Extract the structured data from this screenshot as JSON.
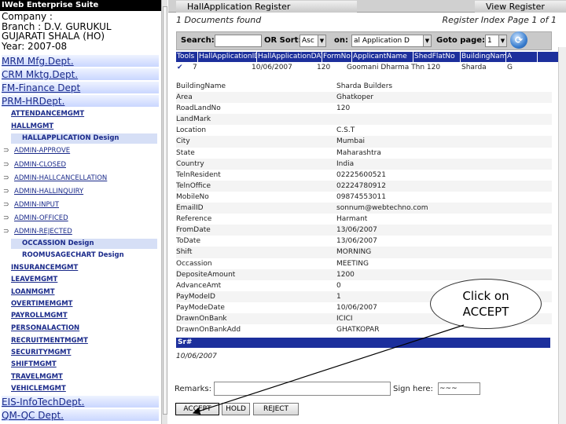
{
  "sidebar": {
    "app_title": "IWeb Enterprise Suite",
    "org": [
      "Company :",
      "Branch : D.V. GURUKUL",
      "GUJARATI SHALA (HO)",
      "Year: 2007-08"
    ],
    "depts_top": [
      "MRM Mfg.Dept.",
      "CRM Mktg.Dept.",
      "FM-Finance Dept",
      "PRM-HRDept."
    ],
    "menus_top": [
      "ATTENDANCEMGMT",
      "HALLMGMT"
    ],
    "design_row_1": "HALLAPPLICATION Design",
    "subs": [
      "ADMIN-APPROVE",
      "ADMIN-CLOSED",
      "ADMIN-HALLCANCELLATION",
      "ADMIN-HALLINQUIRY",
      "ADMIN-INPUT",
      "ADMIN-OFFICED",
      "ADMIN-REJECTED"
    ],
    "occasion_row": "OCCASSION Design",
    "roomusage_row": "ROOMUSAGECHART Design",
    "menus_bottom": [
      "INSURANCEMGMT",
      "LEAVEMGMT",
      "LOANMGMT",
      "OVERTIMEMGMT",
      "PAYROLLMGMT",
      "PERSONALACTION",
      "RECRUITMENTMGMT",
      "SECURITYMGMT",
      "SHIFTMGMT",
      "TRAVELMGMT",
      "VEHICLEMGMT"
    ],
    "depts_bottom": [
      "EIS-InfoTechDept.",
      "QM-QC Dept."
    ]
  },
  "tabs": {
    "hall": "HallApplication Register",
    "view": "View Register"
  },
  "status": {
    "docs_found": "1 Documents found",
    "reg_index": "Register Index Page 1 of 1"
  },
  "search": {
    "label": "Search:",
    "or_sort": "OR Sort:",
    "sort_value": "Asc",
    "on": "on:",
    "on_value": "al Application D",
    "goto": "Goto page:",
    "goto_value": "1"
  },
  "grid": {
    "headers": [
      "Tools",
      "HallApplicationID",
      "HallApplicationDATE",
      "FormNo",
      "ApplicantName",
      "ShedFlatNo",
      "BuildingName",
      "A"
    ],
    "row": [
      "✔",
      "7",
      "10/06/2007",
      "120",
      "Goomani Dharma Thn 120",
      "",
      "Sharda",
      "G"
    ]
  },
  "details": [
    [
      "BuildingName",
      "Sharda Builders"
    ],
    [
      "Area",
      "Ghatkoper"
    ],
    [
      "RoadLandNo",
      "120"
    ],
    [
      "LandMark",
      ""
    ],
    [
      "Location",
      "C.S.T"
    ],
    [
      "City",
      "Mumbai"
    ],
    [
      "State",
      "Maharashtra"
    ],
    [
      "Country",
      "India"
    ],
    [
      "TelnResident",
      "02225600521"
    ],
    [
      "TelnOffice",
      "02224780912"
    ],
    [
      "MobileNo",
      "09874553011"
    ],
    [
      "EmailID",
      "sonnum@webtechno.com"
    ],
    [
      "Reference",
      "Harmant"
    ],
    [
      "FromDate",
      "13/06/2007"
    ],
    [
      "ToDate",
      "13/06/2007"
    ],
    [
      "Shift",
      "MORNING"
    ],
    [
      "Occassion",
      "MEETING"
    ],
    [
      "DepositeAmount",
      "1200"
    ],
    [
      "AdvanceAmt",
      "0"
    ],
    [
      "PayModeID",
      "1"
    ],
    [
      "PayModeDate",
      "10/06/2007"
    ],
    [
      "DrawnOnBank",
      "ICICI"
    ],
    [
      "DrawnOnBankAdd",
      "GHATKOPAR"
    ]
  ],
  "sr_label": "Sr#",
  "sr_date": "10/06/2007",
  "form": {
    "remarks": "Remarks:",
    "sign": "Sign here:",
    "sign_value": "~~~"
  },
  "buttons": {
    "accept": "ACCEPT",
    "hold": "HOLD",
    "reject": "REJECT"
  },
  "callout": {
    "line1": "Click on",
    "line2": "ACCEPT"
  }
}
